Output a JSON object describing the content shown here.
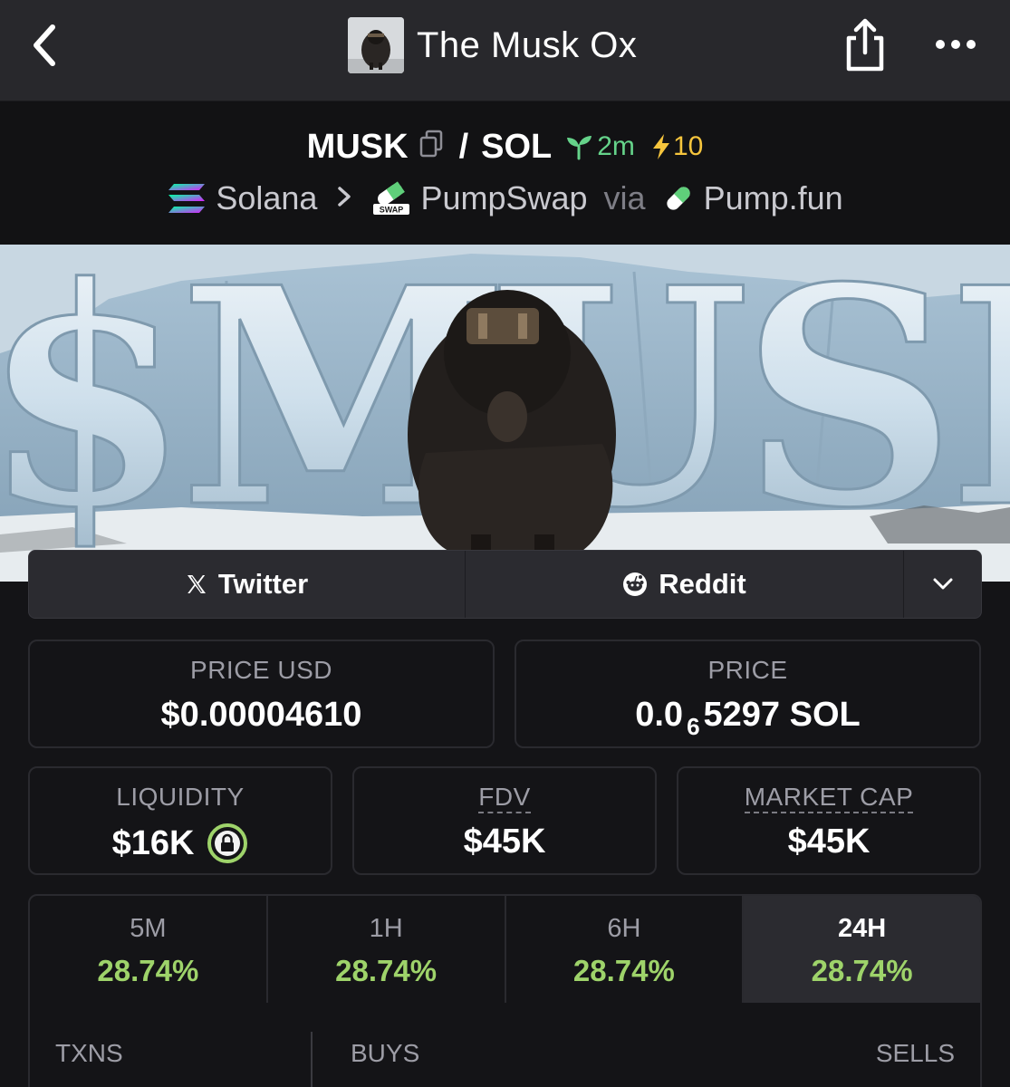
{
  "nav": {
    "title": "The Musk Ox"
  },
  "pair": {
    "base": "MUSK",
    "quote": "SOL",
    "age": "2m",
    "boosts": "10",
    "chain": "Solana",
    "dex": "PumpSwap",
    "via_label": "via",
    "launchpad": "Pump.fun",
    "swap_badge": "SWAP"
  },
  "banner": {
    "text": "$MUSK"
  },
  "socials": {
    "twitter": "Twitter",
    "reddit": "Reddit"
  },
  "stats": {
    "price_usd_label": "PRICE USD",
    "price_usd": "$0.00004610",
    "price_label": "PRICE",
    "price_prefix": "0.0",
    "price_zeros": "6",
    "price_suffix": "5297 SOL",
    "liquidity_label": "LIQUIDITY",
    "liquidity": "$16K",
    "fdv_label": "FDV",
    "fdv": "$45K",
    "mcap_label": "MARKET CAP",
    "mcap": "$45K"
  },
  "timeframes": [
    {
      "label": "5M",
      "value": "28.74%"
    },
    {
      "label": "1H",
      "value": "28.74%"
    },
    {
      "label": "6H",
      "value": "28.74%"
    },
    {
      "label": "24H",
      "value": "28.74%"
    }
  ],
  "txns": {
    "txns_label": "TXNS",
    "buys_label": "BUYS",
    "sells_label": "SELLS"
  },
  "colors": {
    "positive": "#9ed36a",
    "age_green": "#65d38a",
    "boost_yellow": "#f6c53d",
    "background": "#141417"
  },
  "icons": {
    "back": "chevron-left-icon",
    "share": "share-icon",
    "more": "more-horizontal-icon",
    "copy": "copy-icon",
    "seedling": "seedling-icon",
    "bolt": "bolt-icon",
    "solana": "solana-icon",
    "pumpswap": "pumpswap-icon",
    "pill": "pill-icon",
    "x": "x-logo-icon",
    "reddit": "reddit-icon",
    "expand": "chevron-down-icon",
    "lock": "lock-icon"
  }
}
